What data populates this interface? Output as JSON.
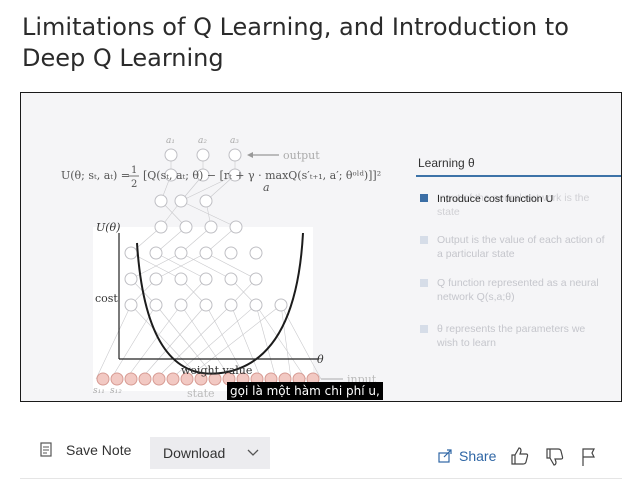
{
  "page": {
    "title": "Limitations of Q Learning, and Introduction to Deep Q Learning"
  },
  "slide": {
    "formula_lhs": "U(θ; sₜ, aₜ) =",
    "formula_frac_num": "1",
    "formula_frac_den": "2",
    "formula_rhs": "[Q(sₜ, aₜ; θ) − [rₜ + γ · maxQ(s′ₜ₊₁, a′; θᵒˡᵈ)]]²",
    "formula_under": "a",
    "output_label": "output",
    "input_label": "input",
    "state_label": "state",
    "action_labels": [
      "a₁",
      "a₂",
      "a₃"
    ],
    "state_labels": [
      "s₁₁",
      "s₁₂"
    ],
    "cost_axis_label": "U(θ)",
    "cost_label": "cost",
    "weight_label": "weight value",
    "theta_axis_label": "θ",
    "panel": {
      "title": "Learning θ",
      "title_ghost": "Learning",
      "bullets": [
        {
          "text": "Introduce cost function U",
          "overlay": "Input of the neural network is the state",
          "active": true
        },
        {
          "text": "Output is the value of each action of a particular state",
          "active": false
        },
        {
          "text": "Q function represented as a neural network Q(s,a;θ)",
          "active": false
        },
        {
          "text": "θ represents the parameters we wish to learn",
          "active": false
        }
      ]
    },
    "caption": "gọi là một hàm chi phí u,"
  },
  "toolbar": {
    "save_note": "Save Note",
    "download": "Download",
    "share": "Share"
  },
  "colors": {
    "accent": "#3d73a8",
    "share": "#2f66a5",
    "node_fill": "#f2c9c3",
    "node_stroke": "#d79b93"
  }
}
